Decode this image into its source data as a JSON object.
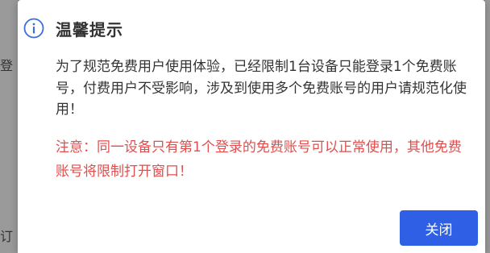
{
  "background": {
    "glyph_top": "登",
    "glyph_bottom": "订"
  },
  "dialog": {
    "icon": "info-circle-icon",
    "icon_color": "#3a6fe0",
    "title": "温馨提示",
    "notice": "为了规范免费用户使用体验，已经限制1台设备只能登录1个免费账号，付费用户不受影响，涉及到使用多个免费账号的用户请规范化使用！",
    "warning": "注意：同一设备只有第1个登录的免费账号可以正常使用，其他免费账号将限制打开窗口！",
    "warning_color": "#e04e4e",
    "close_label": "关闭",
    "button_color": "#2f5fe5"
  }
}
